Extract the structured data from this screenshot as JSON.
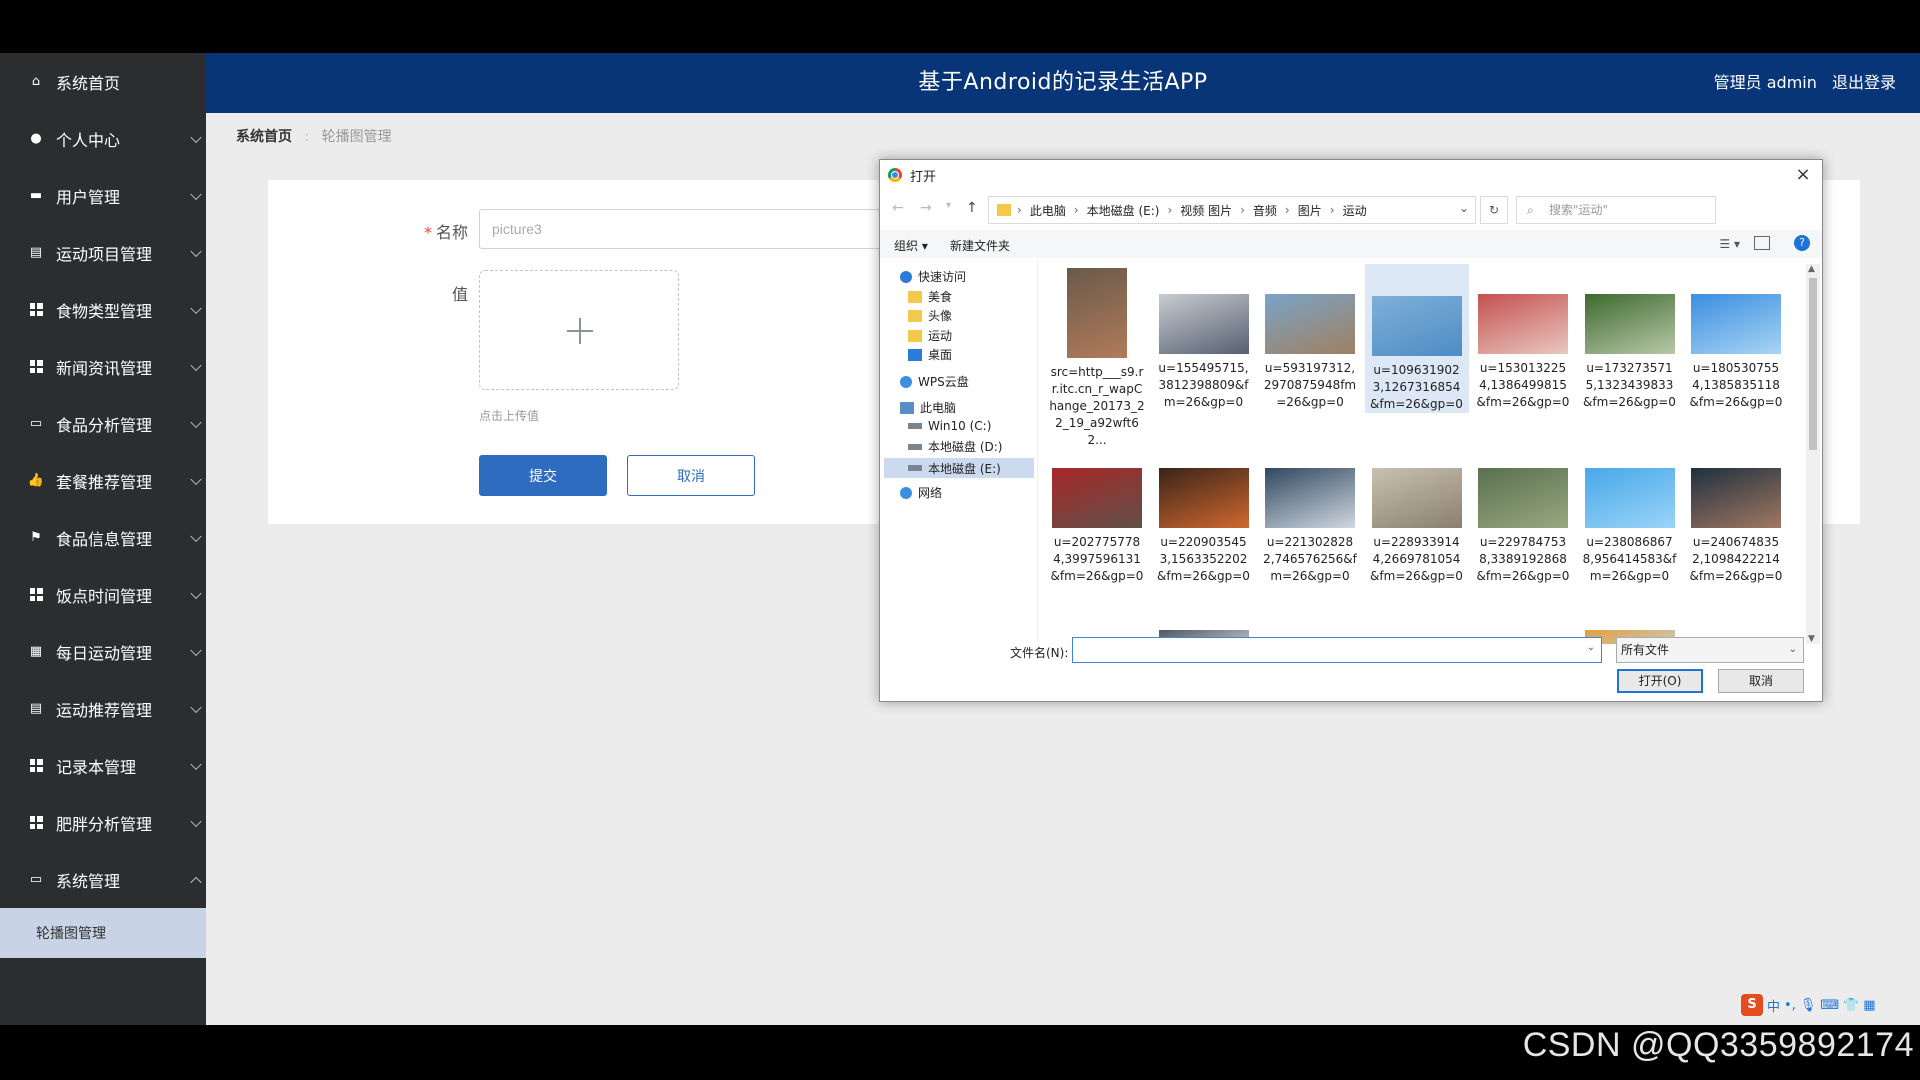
{
  "header": {
    "title": "基于Android的记录生活APP",
    "user_label": "管理员 admin",
    "logout": "退出登录"
  },
  "sidebar": {
    "items": [
      {
        "label": "系统首页",
        "icon": "home-icon"
      },
      {
        "label": "个人中心",
        "icon": "user-icon"
      },
      {
        "label": "用户管理",
        "icon": "briefcase-icon"
      },
      {
        "label": "运动项目管理",
        "icon": "clipboard-icon"
      },
      {
        "label": "食物类型管理",
        "icon": "grid-icon"
      },
      {
        "label": "新闻资讯管理",
        "icon": "grid-icon"
      },
      {
        "label": "食品分析管理",
        "icon": "monitor-icon"
      },
      {
        "label": "套餐推荐管理",
        "icon": "thumbs-up-icon"
      },
      {
        "label": "食品信息管理",
        "icon": "flag-icon"
      },
      {
        "label": "饭点时间管理",
        "icon": "grid-icon"
      },
      {
        "label": "每日运动管理",
        "icon": "table-icon"
      },
      {
        "label": "运动推荐管理",
        "icon": "clipboard-icon"
      },
      {
        "label": "记录本管理",
        "icon": "grid-icon"
      },
      {
        "label": "肥胖分析管理",
        "icon": "grid-icon"
      },
      {
        "label": "系统管理",
        "icon": "monitor-icon"
      }
    ],
    "submenu_active": "轮播图管理"
  },
  "breadcrumb": {
    "home": "系统首页",
    "current": "轮播图管理"
  },
  "form": {
    "name_label": "名称",
    "name_value": "picture3",
    "value_label": "值",
    "upload_hint": "点击上传值",
    "submit": "提交",
    "cancel": "取消"
  },
  "dialog": {
    "title": "打开",
    "path": [
      "此电脑",
      "本地磁盘 (E:)",
      "视频 图片",
      "音频",
      "图片",
      "运动"
    ],
    "search_placeholder": "搜索\"运动\"",
    "organize": "组织 ▾",
    "new_folder": "新建文件夹",
    "nav": [
      {
        "label": "快速访问",
        "icon": "star-icon"
      },
      {
        "label": "美食",
        "icon": "folder-icon"
      },
      {
        "label": "头像",
        "icon": "folder-icon"
      },
      {
        "label": "运动",
        "icon": "folder-icon"
      },
      {
        "label": "桌面",
        "icon": "desktop-icon"
      },
      {
        "label": "WPS云盘",
        "icon": "cloud-icon"
      },
      {
        "label": "此电脑",
        "icon": "computer-icon"
      },
      {
        "label": "Win10 (C:)",
        "icon": "drive-icon"
      },
      {
        "label": "本地磁盘 (D:)",
        "icon": "drive-icon"
      },
      {
        "label": "本地磁盘 (E:)",
        "icon": "drive-icon"
      },
      {
        "label": "网络",
        "icon": "network-icon"
      }
    ],
    "files": [
      {
        "name": "src=http___s9.rr.itc.cn_r_wapChange_20173_22_19_a92wft62...",
        "colors": [
          "#6a5a4a",
          "#b07b5a"
        ]
      },
      {
        "name": "u=155495715,3812398809&fm=26&gp=0",
        "colors": [
          "#c8ccd2",
          "#556070"
        ]
      },
      {
        "name": "u=593197312,2970875948fm=26&gp=0",
        "colors": [
          "#7aa3c8",
          "#a08060"
        ]
      },
      {
        "name": "u=1096319023,1267316854&fm=26&gp=0",
        "colors": [
          "#7fb0d8",
          "#4d8cc5"
        ]
      },
      {
        "name": "u=1530132254,1386499815&fm=26&gp=0",
        "colors": [
          "#c55050",
          "#e8c8c0"
        ]
      },
      {
        "name": "u=1732735715,1323439833&fm=26&gp=0",
        "colors": [
          "#3d6a2e",
          "#b8c8a8"
        ]
      },
      {
        "name": "u=1805307554,1385835118&fm=26&gp=0",
        "colors": [
          "#3b8ee0",
          "#a8d4f4"
        ]
      },
      {
        "name": "u=2027757784,3997596131&fm=26&gp=0",
        "colors": [
          "#a82828",
          "#605048"
        ]
      },
      {
        "name": "u=2209035453,1563352202&fm=26&gp=0",
        "colors": [
          "#3a2418",
          "#d06830"
        ]
      },
      {
        "name": "u=2213028282,746576256&fm=26&gp=0",
        "colors": [
          "#304860",
          "#d0d8e0"
        ]
      },
      {
        "name": "u=2289339144,2669781054&fm=26&gp=0",
        "colors": [
          "#c8c0b0",
          "#8a8070"
        ]
      },
      {
        "name": "u=2297847538,3389192868&fm=26&gp=0",
        "colors": [
          "#5a7050",
          "#98a880"
        ]
      },
      {
        "name": "u=2380868678,956414583&fm=26&gp=0",
        "colors": [
          "#48a8e8",
          "#9ad4f8"
        ]
      },
      {
        "name": "u=2406748352,1098422214&fm=26&gp=0",
        "colors": [
          "#203040",
          "#a07860"
        ]
      }
    ],
    "filename_label": "文件名(N):",
    "filetype": "所有文件",
    "open": "打开(O)",
    "cancel": "取消"
  },
  "watermark": "CSDN @QQ3359892174"
}
